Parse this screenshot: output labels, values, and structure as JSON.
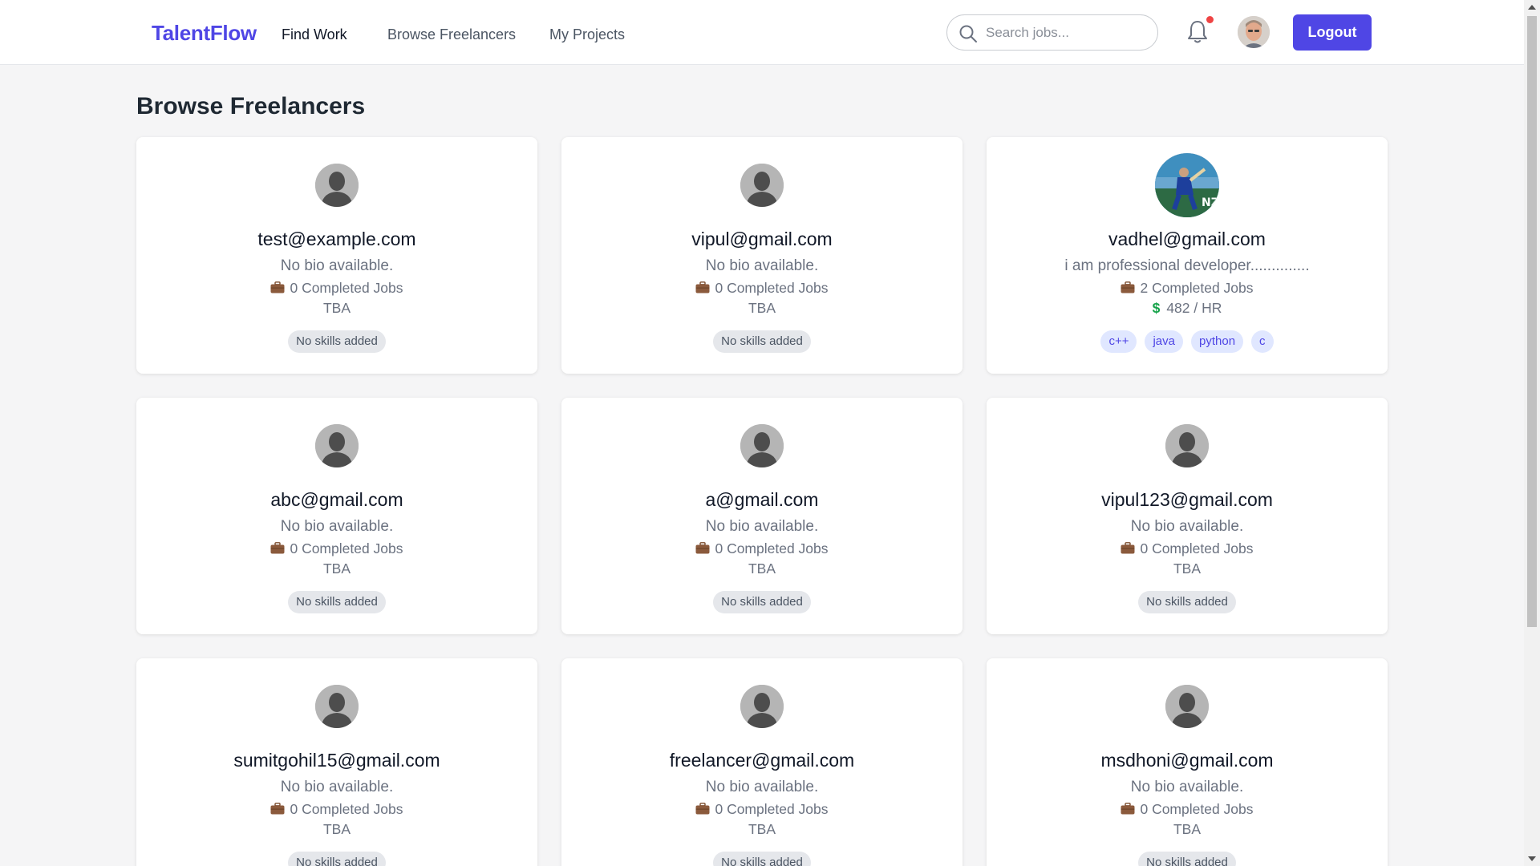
{
  "navbar": {
    "brand": "TalentFlow",
    "links": [
      {
        "label": "Find Work",
        "active": true
      },
      {
        "label": "Browse Freelancers",
        "active": false
      },
      {
        "label": "My Projects",
        "active": false
      }
    ],
    "search": {
      "placeholder": "Search jobs...",
      "value": ""
    },
    "notification_dot_color": "#ef4444",
    "logout_label": "Logout",
    "accent_color": "#4f46e5"
  },
  "page": {
    "title": "Browse Freelancers"
  },
  "freelancers": [
    {
      "email": "test@example.com",
      "bio": "No bio available.",
      "jobs": "0 Completed Jobs",
      "rate": "TBA",
      "has_rate_icon": false,
      "avatar": "default-avatar",
      "skills": [],
      "no_skills_label": "No skills added"
    },
    {
      "email": "vipul@gmail.com",
      "bio": "No bio available.",
      "jobs": "0 Completed Jobs",
      "rate": "TBA",
      "has_rate_icon": false,
      "avatar": "default-avatar",
      "skills": [],
      "no_skills_label": "No skills added"
    },
    {
      "email": "vadhel@gmail.com",
      "bio": "i am professional developer..............",
      "jobs": "2 Completed Jobs",
      "rate": "482 / HR",
      "has_rate_icon": true,
      "avatar": "photo-avatar",
      "skills": [
        "c++",
        "java",
        "python",
        "c"
      ],
      "no_skills_label": ""
    },
    {
      "email": "abc@gmail.com",
      "bio": "No bio available.",
      "jobs": "0 Completed Jobs",
      "rate": "TBA",
      "has_rate_icon": false,
      "avatar": "default-avatar",
      "skills": [],
      "no_skills_label": "No skills added"
    },
    {
      "email": "a@gmail.com",
      "bio": "No bio available.",
      "jobs": "0 Completed Jobs",
      "rate": "TBA",
      "has_rate_icon": false,
      "avatar": "default-avatar",
      "skills": [],
      "no_skills_label": "No skills added"
    },
    {
      "email": "vipul123@gmail.com",
      "bio": "No bio available.",
      "jobs": "0 Completed Jobs",
      "rate": "TBA",
      "has_rate_icon": false,
      "avatar": "default-avatar",
      "skills": [],
      "no_skills_label": "No skills added"
    },
    {
      "email": "sumitgohil15@gmail.com",
      "bio": "No bio available.",
      "jobs": "0 Completed Jobs",
      "rate": "TBA",
      "has_rate_icon": false,
      "avatar": "default-avatar",
      "skills": [],
      "no_skills_label": "No skills added"
    },
    {
      "email": "freelancer@gmail.com",
      "bio": "No bio available.",
      "jobs": "0 Completed Jobs",
      "rate": "TBA",
      "has_rate_icon": false,
      "avatar": "default-avatar",
      "skills": [],
      "no_skills_label": "No skills added"
    },
    {
      "email": "msdhoni@gmail.com",
      "bio": "No bio available.",
      "jobs": "0 Completed Jobs",
      "rate": "TBA",
      "has_rate_icon": false,
      "avatar": "default-avatar",
      "skills": [],
      "no_skills_label": "No skills added"
    }
  ]
}
